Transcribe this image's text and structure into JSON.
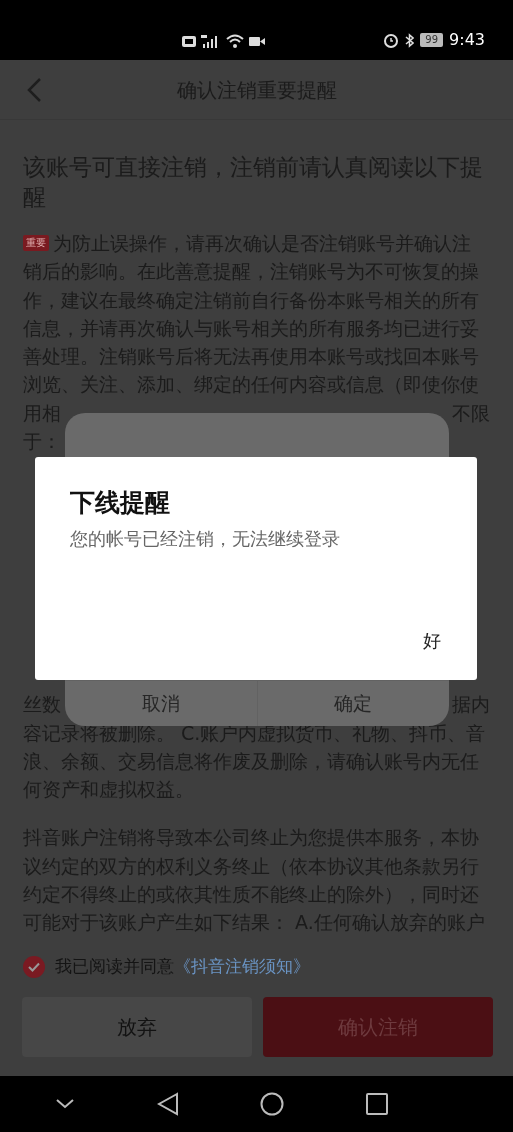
{
  "status_bar": {
    "battery": "99",
    "time": "9:43"
  },
  "header": {
    "title": "确认注销重要提醒"
  },
  "heading": "该账号可直接注销，注销前请认真阅读以下提醒",
  "paragraphs": [
    {
      "lines": [
        {
          "badge": "重要",
          "left": "为防止误操作，请再次确认是否注销账号并确认注"
        },
        {
          "left": "销后的影响。在此善意提醒，注销账号为不可恢复的操"
        },
        {
          "left": "作，建议在最终确定注销前自行备份本账号相关的所有"
        },
        {
          "left": "信息，并请再次确认与账号相关的所有服务均已进行妥"
        },
        {
          "left": "善处理。注销账号后将无法再使用本账号或找回本账号"
        },
        {
          "left": "浏览、关注、添加、绑定的任何内容或信息（即使你使"
        },
        {
          "left": "用相",
          "right": "不限"
        },
        {
          "left": "于："
        }
      ]
    },
    {
      "lines": [
        {
          "left": "丝数",
          "right": "据内"
        },
        {
          "left": "容记录将被删除。 C.账户内虚拟货币、礼物、抖币、音"
        },
        {
          "left": "浪、余额、交易信息将作废及删除，请确认账号内无任"
        },
        {
          "left": "何资产和虚拟权益。"
        }
      ]
    },
    {
      "lines": [
        {
          "left": "抖音账户注销将导致本公司终止为您提供本服务，本协"
        },
        {
          "left": "议约定的双方的权利义务终止（依本协议其他条款另行"
        },
        {
          "left": "约定不得终止的或依其性质不能终止的除外），同时还"
        },
        {
          "left": "可能对于该账户产生如下结果： A.任何确认放弃的账户"
        }
      ]
    }
  ],
  "agreement": {
    "checked": true,
    "label": "我已阅读并同意",
    "link": "《抖音注销须知》"
  },
  "actions": [
    {
      "label": "放弃",
      "kind": "secondary"
    },
    {
      "label": "确认注销",
      "kind": "primary"
    }
  ],
  "dialog_behind": {
    "buttons": [
      "取消",
      "确定"
    ]
  },
  "dialog": {
    "title": "下线提醒",
    "message": "您的帐号已经注销，无法继续登录",
    "button": "好"
  }
}
